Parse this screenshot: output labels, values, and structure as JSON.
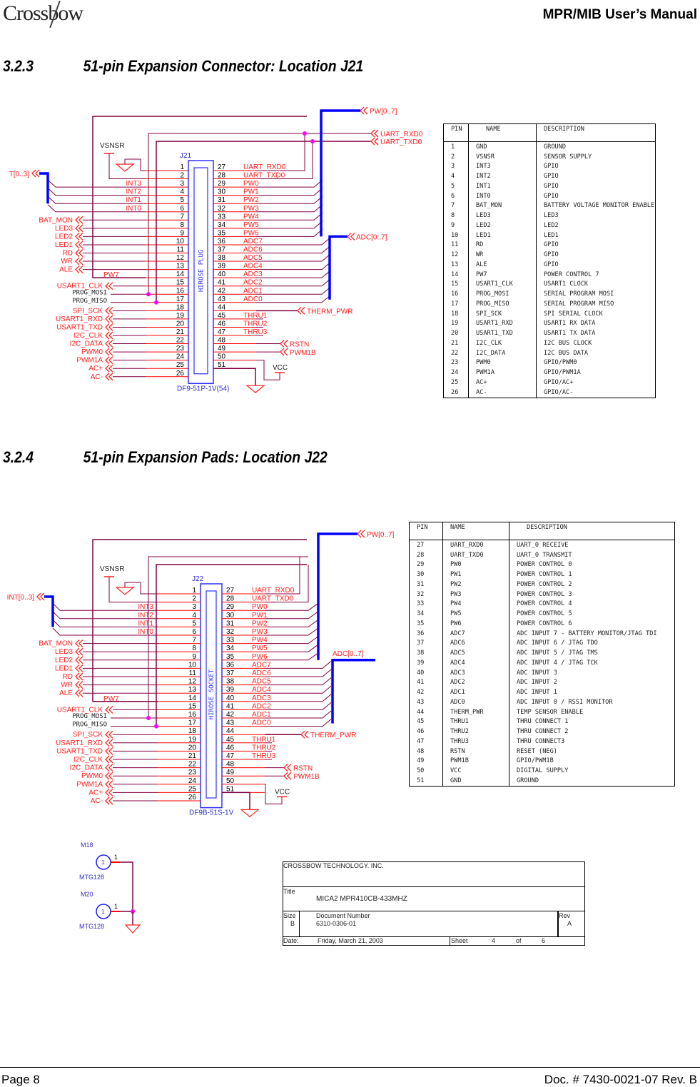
{
  "header": {
    "logo": "Crossbow",
    "manual_title": "MPR/MIB User’s Manual"
  },
  "sections": [
    {
      "number": "3.2.3",
      "title": "51-pin Expansion Connector: Location J21"
    },
    {
      "number": "3.2.4",
      "title": "51-pin Expansion Pads: Location J22"
    }
  ],
  "colors": {
    "net_label": "#ff2020",
    "wire": "#800040",
    "bus": "#0000ff",
    "component": "#3030ff",
    "junction": "#ff00ff",
    "pin_line": "#ff0000"
  },
  "schematics": [
    {
      "ref": "J21",
      "part": "DF9-51P-1V(54)",
      "body_label": "HIROSE   PLUG",
      "power_label": "VSNSR",
      "vcc_label": "VCC",
      "pw7_label": "PW7",
      "int_bus_label": "T[0..3]",
      "pw_bus_label": "PW[0..7]",
      "adc_bus_label": "ADC[0..7]",
      "left_nets": [
        "",
        "",
        "INT3",
        "INT2",
        "INT1",
        "INT0",
        "BAT_MON",
        "LED3",
        "LED2",
        "LED1",
        "RD",
        "WR",
        "ALE",
        "",
        "USART1_CLK",
        "PROG_MOSI",
        "PROG_MISO",
        "SPI_SCK",
        "USART1_RXD",
        "USART1_TXD",
        "I2C_CLK",
        "I2C_DATA",
        "PWM0",
        "PWM1A",
        "AC+",
        "AC-"
      ],
      "right_nets": [
        "UART_RXD0",
        "UART_TXD0",
        "PW0",
        "PW1",
        "PW2",
        "PW3",
        "PW4",
        "PW5",
        "PW6",
        "ADC7",
        "ADC6",
        "ADC5",
        "ADC4",
        "ADC3",
        "ADC2",
        "ADC1",
        "ADC0",
        "",
        "THRU1",
        "THRU2",
        "THRU3",
        "",
        "",
        "",
        ""
      ],
      "offpage": {
        "uart_rxd0": "UART_RXD0",
        "uart_txd0": "UART_TXD0",
        "therm_pwr": "THERM_PWR",
        "rstn": "RSTN",
        "pwm1b": "PWM1B"
      }
    },
    {
      "ref": "J22",
      "part": "DF9B-51S-1V",
      "body_label": "HIROSE SOCKET",
      "power_label": "VSNSR",
      "vcc_label": "VCC",
      "pw7_label": "PW7",
      "int_bus_label": "INT[0..3]",
      "pw_bus_label": "PW[0..7]",
      "adc_bus_label": "ADC[0..7]",
      "left_nets": [
        "",
        "",
        "INT3",
        "INT2",
        "INT1",
        "INT0",
        "BAT_MON",
        "LED3",
        "LED2",
        "LED1",
        "RD",
        "WR",
        "ALE",
        "",
        "USART1_CLK",
        "PROG_MOSI",
        "PROG_MISO",
        "SPI_SCK",
        "USART1_RXD",
        "USART1_TXD",
        "I2C_CLK",
        "I2C_DATA",
        "PWM0",
        "PWM1A",
        "AC+",
        "AC-"
      ],
      "right_nets": [
        "UART_RXD0",
        "UART_TXD0",
        "PW0",
        "PW1",
        "PW2",
        "PW3",
        "PW4",
        "PW5",
        "PW6",
        "ADC7",
        "ADC6",
        "ADC5",
        "ADC4",
        "ADC3",
        "ADC2",
        "ADC1",
        "ADC0",
        "",
        "THRU1",
        "THRU2",
        "THRU3",
        "",
        "",
        "",
        ""
      ],
      "offpage": {
        "therm_pwr": "THERM_PWR",
        "rstn": "RSTN",
        "pwm1b": "PWM1B"
      }
    }
  ],
  "table_j21": {
    "headers": [
      "PIN",
      "NAME",
      "DESCRIPTION"
    ],
    "rows": [
      [
        "1",
        "GND",
        "GROUND"
      ],
      [
        "2",
        "VSNSR",
        "SENSOR SUPPLY"
      ],
      [
        "3",
        "INT3",
        "GPIO"
      ],
      [
        "4",
        "INT2",
        "GPIO"
      ],
      [
        "5",
        "INT1",
        "GPIO"
      ],
      [
        "6",
        "INT0",
        "GPIO"
      ],
      [
        "7",
        "BAT_MON",
        "BATTERY VOLTAGE MONITOR ENABLE"
      ],
      [
        "8",
        "LED3",
        "LED3"
      ],
      [
        "9",
        "LED2",
        "LED2"
      ],
      [
        "10",
        "LED1",
        "LED1"
      ],
      [
        "11",
        "RD",
        "GPIO"
      ],
      [
        "12",
        "WR",
        "GPIO"
      ],
      [
        "13",
        "ALE",
        "GPIO"
      ],
      [
        "14",
        "PW7",
        "POWER CONTROL 7"
      ],
      [
        "15",
        "USART1_CLK",
        "USART1  CLOCK"
      ],
      [
        "16",
        "PROG_MOSI",
        "SERIAL PROGRAM MOSI"
      ],
      [
        "17",
        "PROG_MISO",
        "SERIAL PROGRAM MISO"
      ],
      [
        "18",
        "SPI_SCK",
        "SPI SERIAL CLOCK"
      ],
      [
        "19",
        "USART1_RXD",
        "USART1 RX DATA"
      ],
      [
        "20",
        "USART1_TXD",
        "USART1 TX DATA"
      ],
      [
        "21",
        "I2C_CLK",
        "I2C BUS CLOCK"
      ],
      [
        "22",
        "I2C_DATA",
        "I2C BUS DATA"
      ],
      [
        "23",
        "PWM0",
        "GPIO/PWM0"
      ],
      [
        "24",
        "PWM1A",
        "GPIO/PWM1A"
      ],
      [
        "25",
        "AC+",
        "GPIO/AC+"
      ],
      [
        "26",
        "AC-",
        "GPIO/AC-"
      ]
    ]
  },
  "table_j22": {
    "headers": [
      "PIN",
      "NAME",
      "DESCRIPTION"
    ],
    "rows": [
      [
        "27",
        "UART_RXD0",
        "UART_0 RECEIVE"
      ],
      [
        "28",
        "UART_TXD0",
        "UART_0 TRANSMIT"
      ],
      [
        "29",
        "PW0",
        "POWER CONTROL 0"
      ],
      [
        "30",
        "PW1",
        "POWER CONTROL 1"
      ],
      [
        "31",
        "PW2",
        "POWER CONTROL 2"
      ],
      [
        "32",
        "PW3",
        "POWER CONTROL 3"
      ],
      [
        "33",
        "PW4",
        "POWER CONTROL 4"
      ],
      [
        "34",
        "PW5",
        "POWER CONTROL 5"
      ],
      [
        "35",
        "PW6",
        "POWER CONTROL 6"
      ],
      [
        "36",
        "ADC7",
        "ADC INPUT 7 - BATTERY MONITOR/JTAG TDI"
      ],
      [
        "37",
        "ADC6",
        "ADC INPUT 6 / JTAG TDO"
      ],
      [
        "38",
        "ADC5",
        "ADC INPUT 5 / JTAG TMS"
      ],
      [
        "39",
        "ADC4",
        "ADC INPUT 4 / JTAG TCK"
      ],
      [
        "40",
        "ADC3",
        "ADC INPUT 3"
      ],
      [
        "41",
        "ADC2",
        "ADC INPUT 2"
      ],
      [
        "42",
        "ADC1",
        "ADC INPUT 1"
      ],
      [
        "43",
        "ADC0",
        "ADC INPUT 0 / RSSI MONITOR"
      ],
      [
        "44",
        "THERM_PWR",
        "TEMP SENSOR ENABLE"
      ],
      [
        "45",
        "THRU1",
        "THRU CONNECT 1"
      ],
      [
        "46",
        "THRU2",
        "THRU CONNECT 2"
      ],
      [
        "47",
        "THRU3",
        "THRU CONNECT3"
      ],
      [
        "48",
        "RSTN",
        "RESET (NEG)"
      ],
      [
        "49",
        "PWM1B",
        "GPIO/PWM1B"
      ],
      [
        "50",
        "VCC",
        "DIGITAL SUPPLY"
      ],
      [
        "51",
        "GND",
        "GROUND"
      ]
    ]
  },
  "mounting": [
    {
      "ref": "M18",
      "pin": "1",
      "part": "MTG128"
    },
    {
      "ref": "M20",
      "pin": "1",
      "part": "MTG128"
    }
  ],
  "title_block": {
    "company": "CROSSBOW TECHNOLOGY. INC.",
    "title_label": "Title",
    "title": "MICA2 MPR410CB-433MHZ",
    "size_label": "Size",
    "size": "B",
    "docnum_label": "Document Number",
    "docnum": "6310-0306-01",
    "rev_label": "Rev",
    "rev": "A",
    "date_label": "Date:",
    "date": "Friday, March 21, 2003",
    "sheet_label": "Sheet",
    "sheet": "4",
    "of_label": "of",
    "of": "6"
  },
  "footer": {
    "page": "Page 8",
    "doc": "Doc. # 7430-0021-07 Rev. B"
  }
}
